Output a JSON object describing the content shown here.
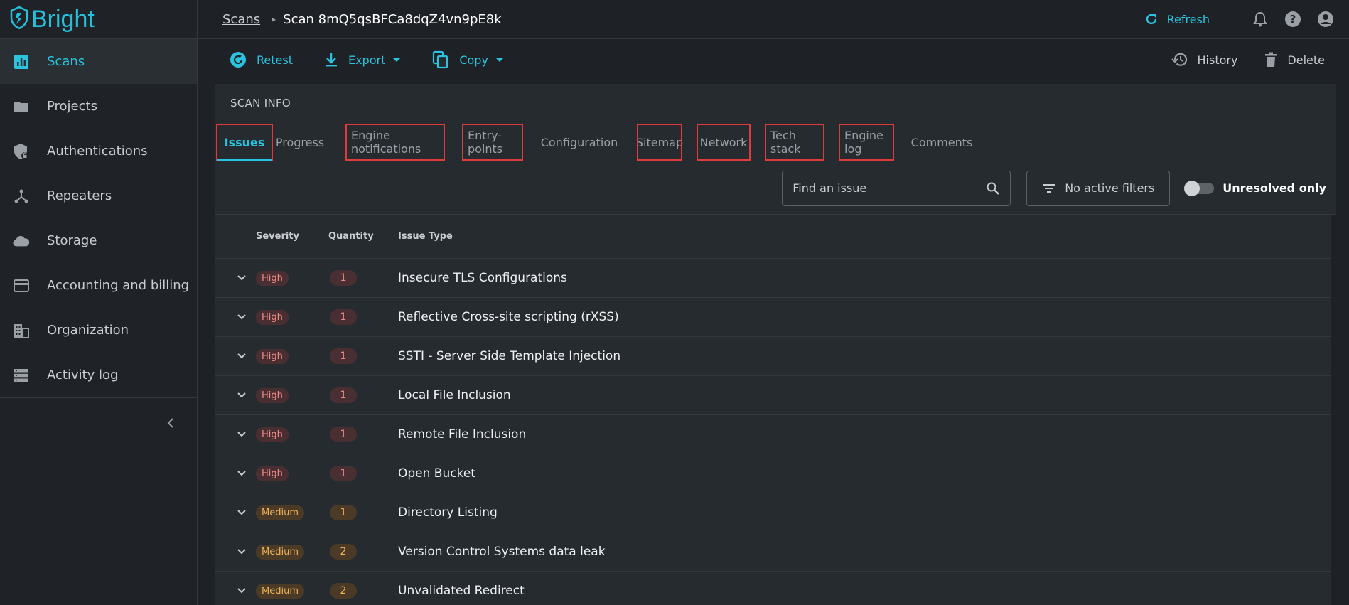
{
  "brand": {
    "name": "Bright"
  },
  "sidebar": {
    "items": [
      {
        "label": "Scans",
        "icon": "chart-icon",
        "active": true
      },
      {
        "label": "Projects",
        "icon": "folder-icon"
      },
      {
        "label": "Authentications",
        "icon": "shield-lock-icon"
      },
      {
        "label": "Repeaters",
        "icon": "network-hub-icon"
      },
      {
        "label": "Storage",
        "icon": "cloud-icon"
      },
      {
        "label": "Accounting and billing",
        "icon": "credit-card-icon"
      },
      {
        "label": "Organization",
        "icon": "building-icon"
      },
      {
        "label": "Activity log",
        "icon": "list-icon"
      }
    ]
  },
  "header": {
    "breadcrumb_root": "Scans",
    "breadcrumb_current": "Scan 8mQ5qsBFCa8dqZ4vn9pE8k",
    "refresh_label": "Refresh"
  },
  "toolbar": {
    "retest_label": "Retest",
    "export_label": "Export",
    "copy_label": "Copy",
    "history_label": "History",
    "delete_label": "Delete"
  },
  "panel": {
    "title": "SCAN INFO",
    "tabs": [
      {
        "label": "Issues",
        "active": true,
        "highlighted": true
      },
      {
        "label": "Progress",
        "highlighted": false
      },
      {
        "label": "Engine notifications",
        "highlighted": true
      },
      {
        "label": "Entry-points",
        "highlighted": true
      },
      {
        "label": "Configuration",
        "highlighted": false
      },
      {
        "label": "Sitemap",
        "highlighted": true
      },
      {
        "label": "Network",
        "highlighted": true
      },
      {
        "label": "Tech stack",
        "highlighted": true
      },
      {
        "label": "Engine log",
        "highlighted": true
      },
      {
        "label": "Comments",
        "highlighted": false
      }
    ],
    "search_placeholder": "Find an issue",
    "filter_label": "No active filters",
    "toggle_label": "Unresolved only"
  },
  "table": {
    "headers": {
      "severity": "Severity",
      "quantity": "Quantity",
      "issue_type": "Issue Type"
    },
    "rows": [
      {
        "severity": "High",
        "quantity": "1",
        "issue_type": "Insecure TLS Configurations"
      },
      {
        "severity": "High",
        "quantity": "1",
        "issue_type": "Reflective Cross-site scripting (rXSS)"
      },
      {
        "severity": "High",
        "quantity": "1",
        "issue_type": "SSTI - Server Side Template Injection"
      },
      {
        "severity": "High",
        "quantity": "1",
        "issue_type": "Local File Inclusion"
      },
      {
        "severity": "High",
        "quantity": "1",
        "issue_type": "Remote File Inclusion"
      },
      {
        "severity": "High",
        "quantity": "1",
        "issue_type": "Open Bucket"
      },
      {
        "severity": "Medium",
        "quantity": "1",
        "issue_type": "Directory Listing"
      },
      {
        "severity": "Medium",
        "quantity": "2",
        "issue_type": "Version Control Systems data leak"
      },
      {
        "severity": "Medium",
        "quantity": "2",
        "issue_type": "Unvalidated Redirect"
      }
    ]
  },
  "colors": {
    "accent": "#2bc4e0",
    "highlight_box": "#e03b3b",
    "high": "#f08a8a",
    "medium": "#f0b258"
  }
}
